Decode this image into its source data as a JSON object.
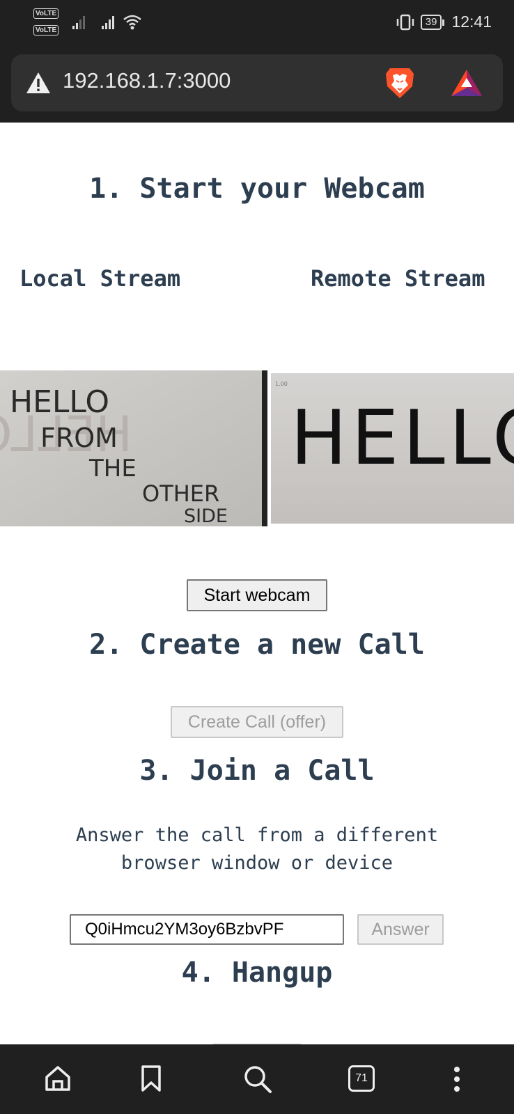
{
  "status_bar": {
    "sim1": "VoLTE",
    "sim2": "VoLTE",
    "battery": "39",
    "time": "12:41"
  },
  "browser": {
    "url": "192.168.1.7:3000",
    "tab_count": "71"
  },
  "section1": {
    "heading": "1. Start your Webcam",
    "local_label": "Local Stream",
    "remote_label": "Remote Stream",
    "start_button": "Start webcam"
  },
  "local_video": {
    "lines": [
      "HELLO",
      "FROM",
      "THE",
      "OTHER",
      "SIDE"
    ]
  },
  "remote_video": {
    "overlay": "1.00",
    "text": "HELLO"
  },
  "section2": {
    "heading": "2. Create a new Call",
    "create_button": "Create Call (offer)"
  },
  "section3": {
    "heading": "3. Join a Call",
    "description_line1": "Answer the call from a different",
    "description_line2": "browser window or device",
    "call_id_value": "Q0iHmcu2YM3oy6BzbvPF",
    "answer_button": "Answer"
  },
  "section4": {
    "heading": "4. Hangup"
  },
  "icons": {
    "warning": "warning-icon",
    "brave": "brave-lion-icon",
    "bat": "bat-triangle-icon",
    "home": "home-icon",
    "bookmark": "bookmark-icon",
    "search": "search-icon",
    "menu": "more-vertical-icon"
  },
  "colors": {
    "heading": "#2c3e50",
    "chrome_dark": "#202020",
    "brave_orange": "#fb542b"
  }
}
